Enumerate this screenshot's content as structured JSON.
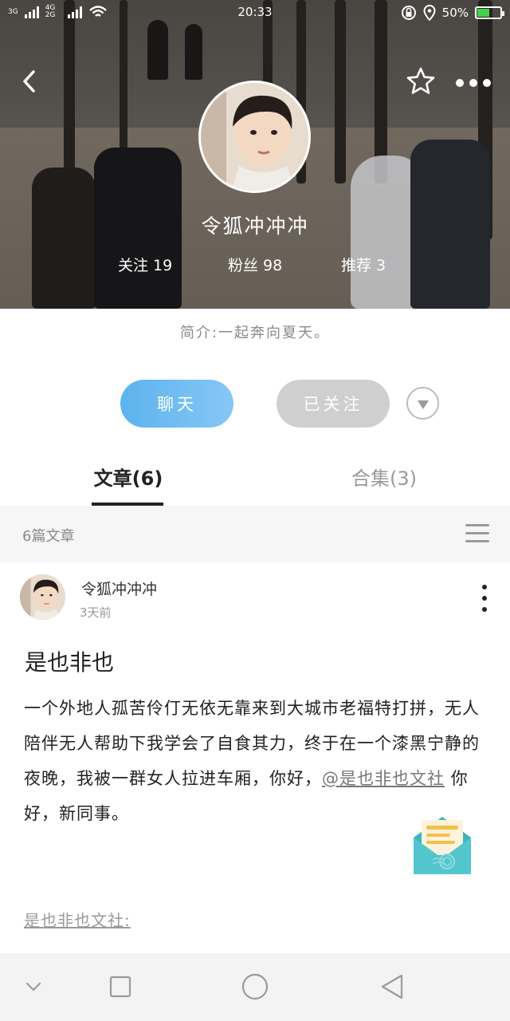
{
  "status_bar": {
    "time": "20:33",
    "signal_1_label": "3G",
    "signal_2_label": "4G 2G",
    "battery": "50%",
    "battery_level": 0.5
  },
  "header": {
    "back_icon": "chevron-left-icon",
    "favorite_icon": "star-outline-icon",
    "more_icon": "more-horizontal-icon"
  },
  "profile": {
    "nickname": "令狐冲冲冲",
    "following": "关注 19",
    "followers": "粉丝 98",
    "recommend": "推荐 3",
    "intro": "简介:一起奔向夏天。"
  },
  "actions": {
    "chat_label": "聊天",
    "follow_label": "已关注",
    "dropdown_icon": "caret-down-icon"
  },
  "tabs": {
    "articles": "文章(6)",
    "collections": "合集(3)"
  },
  "list": {
    "count_label": "6篇文章",
    "menu_icon": "hamburger-menu-icon"
  },
  "post": {
    "author": "令狐冲冲冲",
    "time": "3天前",
    "title": "是也非也",
    "body_before": "一个外地人孤苦伶仃无依无靠来到大城市老福特打拼，无人陪伴无人帮助下我学会了自食其力，终于在一个漆黑宁静的夜晚，我被一群女人拉进车厢，你好，",
    "mention": "@是也非也文社",
    "body_after": " 你好，新同事。",
    "tag": "是也非也文社:"
  },
  "colors": {
    "accent_blue": "#5cb3ee",
    "followed_gray": "#cfcfcf",
    "mail_teal": "#4fc2c8"
  }
}
